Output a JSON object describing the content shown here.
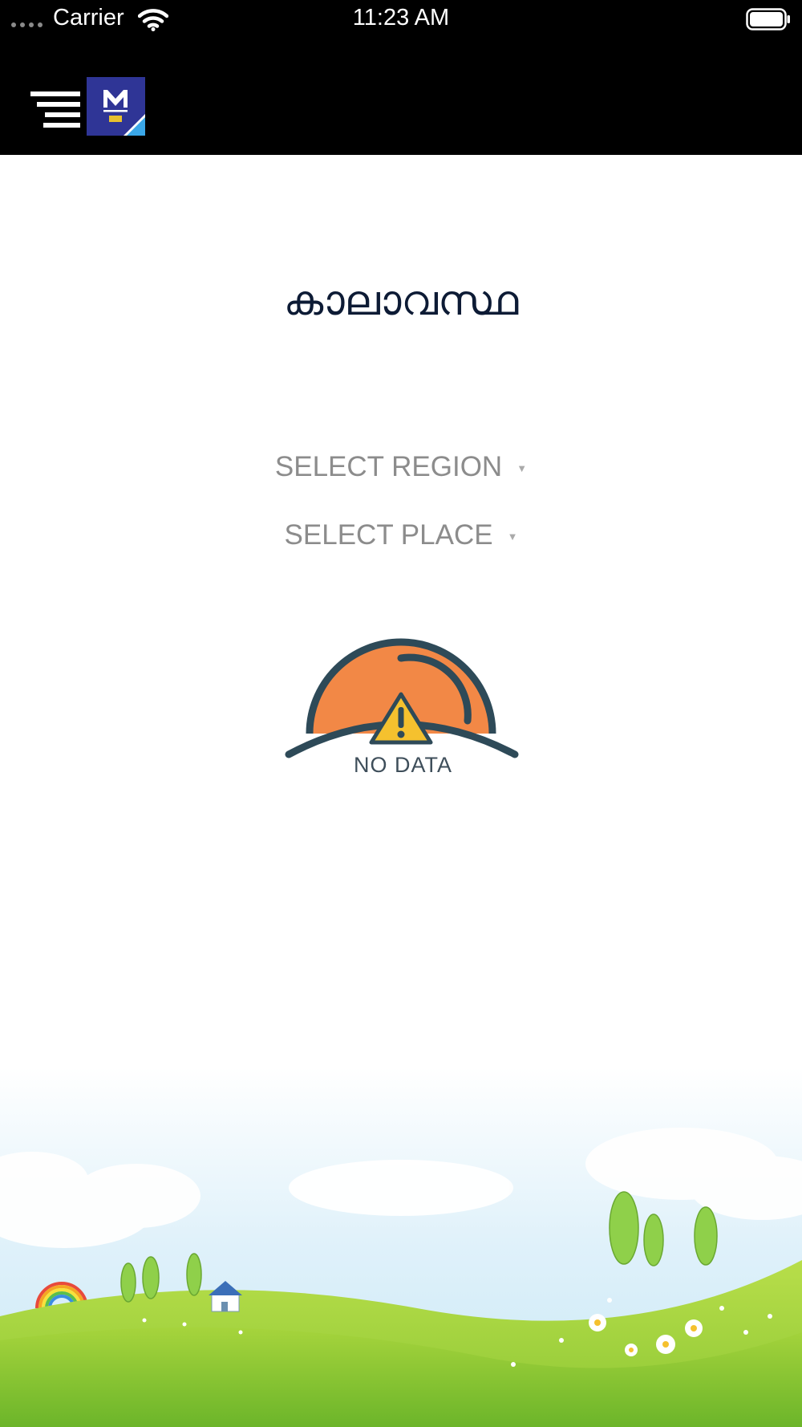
{
  "status_bar": {
    "carrier": "Carrier",
    "time": "11:23 AM"
  },
  "header": {
    "menu_icon": "hamburger-menu-icon",
    "logo_icon": "app-logo-m-pro"
  },
  "page": {
    "title": "കാലാവസ്ഥ",
    "region_select": "SELECT REGION",
    "place_select": "SELECT PLACE",
    "empty_state": {
      "label": "NO DATA",
      "icon": "sun-warning-icon"
    }
  },
  "colors": {
    "header_bg": "#000000",
    "sun_orange": "#f28846",
    "outline": "#2e4a58",
    "warning_yellow": "#f5c12e",
    "logo_blue": "#2f3596",
    "grass_green": "#8fcb34"
  }
}
